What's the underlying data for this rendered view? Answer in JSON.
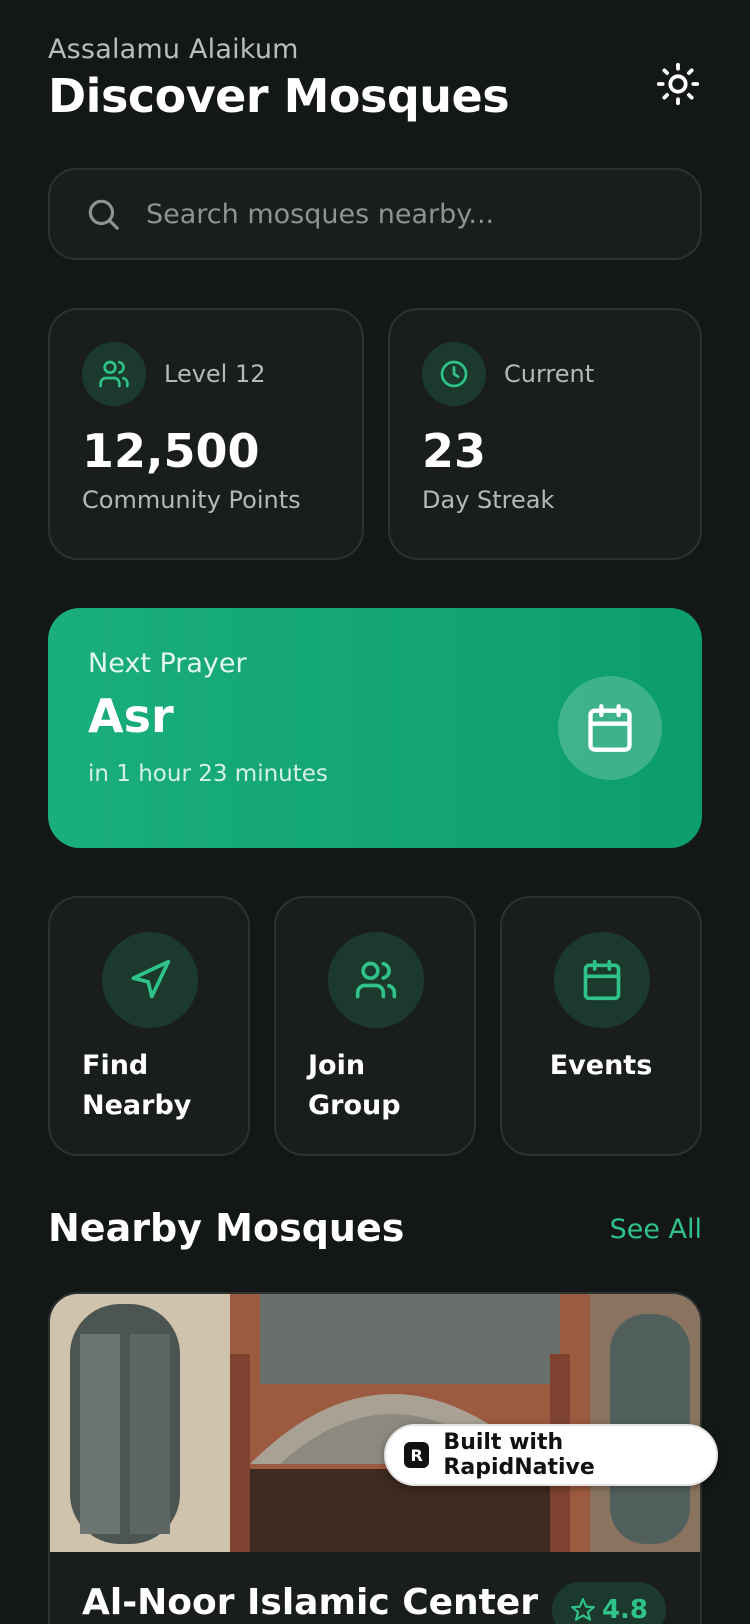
{
  "header": {
    "greeting": "Assalamu Alaikum",
    "title": "Discover Mosques",
    "theme_icon": "sun-icon"
  },
  "search": {
    "placeholder": "Search mosques nearby..."
  },
  "stats": [
    {
      "icon": "users-icon",
      "label": "Level 12",
      "value": "12,500",
      "sub": "Community Points"
    },
    {
      "icon": "clock-icon",
      "label": "Current",
      "value": "23",
      "sub": "Day Streak"
    }
  ],
  "next_prayer": {
    "label": "Next Prayer",
    "name": "Asr",
    "time": "in 1 hour 23 minutes",
    "icon": "calendar-icon"
  },
  "actions": [
    {
      "icon": "navigation-icon",
      "label": "Find Nearby"
    },
    {
      "icon": "users-icon",
      "label": "Join Group"
    },
    {
      "icon": "calendar-icon",
      "label": "Events"
    }
  ],
  "nearby": {
    "title": "Nearby Mosques",
    "see_all": "See All",
    "mosques": [
      {
        "name": "Al-Noor Islamic Center",
        "rating": "4.8"
      }
    ]
  },
  "badge": {
    "text": "Built with RapidNative"
  },
  "colors": {
    "background": "#131715",
    "accent": "#2fc28b",
    "card": "#191d1b",
    "prayer_card": "#10a672"
  }
}
